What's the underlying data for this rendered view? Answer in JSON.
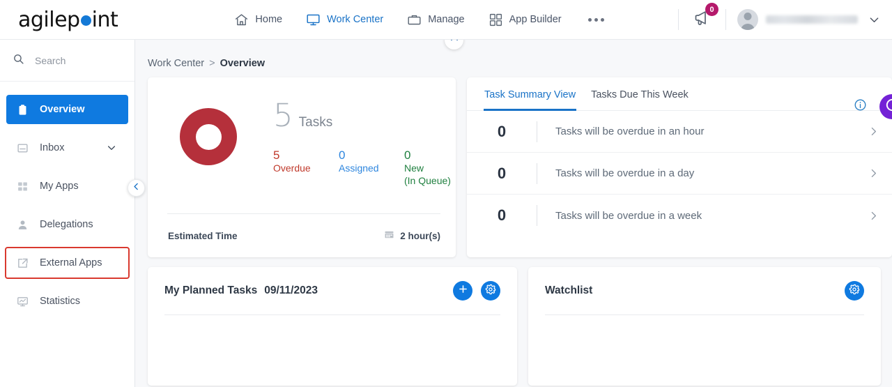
{
  "brand": {
    "name_part1": "agilep",
    "name_part2": "int",
    "dot_color": "#1479d6"
  },
  "topnav": {
    "items": [
      {
        "label": "Home",
        "icon": "home-icon",
        "active": false
      },
      {
        "label": "Work Center",
        "icon": "monitor-icon",
        "active": true
      },
      {
        "label": "Manage",
        "icon": "briefcase-icon",
        "active": false
      },
      {
        "label": "App Builder",
        "icon": "grid-icon",
        "active": false
      }
    ],
    "more_label": "...",
    "notification_count": "0",
    "user_name": ""
  },
  "sidebar": {
    "search_placeholder": "Search",
    "items": [
      {
        "label": "Overview",
        "icon": "clipboard-icon",
        "active": true,
        "highlighted": false,
        "chevron": false
      },
      {
        "label": "Inbox",
        "icon": "inbox-icon",
        "active": false,
        "highlighted": false,
        "chevron": true
      },
      {
        "label": "My Apps",
        "icon": "apps-grid-icon",
        "active": false,
        "highlighted": false,
        "chevron": false
      },
      {
        "label": "Delegations",
        "icon": "person-icon",
        "active": false,
        "highlighted": false,
        "chevron": false
      },
      {
        "label": "External Apps",
        "icon": "external-link-icon",
        "active": false,
        "highlighted": true,
        "chevron": false
      },
      {
        "label": "Statistics",
        "icon": "chart-monitor-icon",
        "active": false,
        "highlighted": false,
        "chevron": false
      }
    ]
  },
  "breadcrumb": {
    "parent": "Work Center",
    "separator": ">",
    "current": "Overview"
  },
  "summary_card": {
    "total": "5",
    "total_label": "Tasks",
    "donut_color": "#b5303b",
    "stats": [
      {
        "value": "5",
        "label": "Overdue",
        "color": "#c0392b"
      },
      {
        "value": "0",
        "label": "Assigned",
        "color": "#2e86de"
      },
      {
        "value": "0",
        "label": "New\n(In Queue)",
        "color": "#208040"
      }
    ],
    "estimated_time_label": "Estimated Time",
    "estimated_time_value": "2 hour(s)"
  },
  "task_summary": {
    "tabs": [
      {
        "label": "Task Summary View",
        "active": true
      },
      {
        "label": "Tasks Due This Week",
        "active": false
      }
    ],
    "rows": [
      {
        "count": "0",
        "text": "Tasks will be overdue in an hour"
      },
      {
        "count": "0",
        "text": "Tasks will be overdue in a day"
      },
      {
        "count": "0",
        "text": "Tasks will be overdue in a week"
      }
    ]
  },
  "planned_tasks": {
    "title": "My Planned Tasks",
    "date": "09/11/2023",
    "add_label": "+",
    "settings_label": "settings"
  },
  "watchlist": {
    "title": "Watchlist",
    "settings_label": "settings"
  },
  "colors": {
    "accent_blue": "#0f7ae0",
    "link_blue": "#1a73c7",
    "refresh_purple": "#7322d6",
    "badge_magenta": "#b5196b",
    "highlight_red": "#d9392f"
  }
}
